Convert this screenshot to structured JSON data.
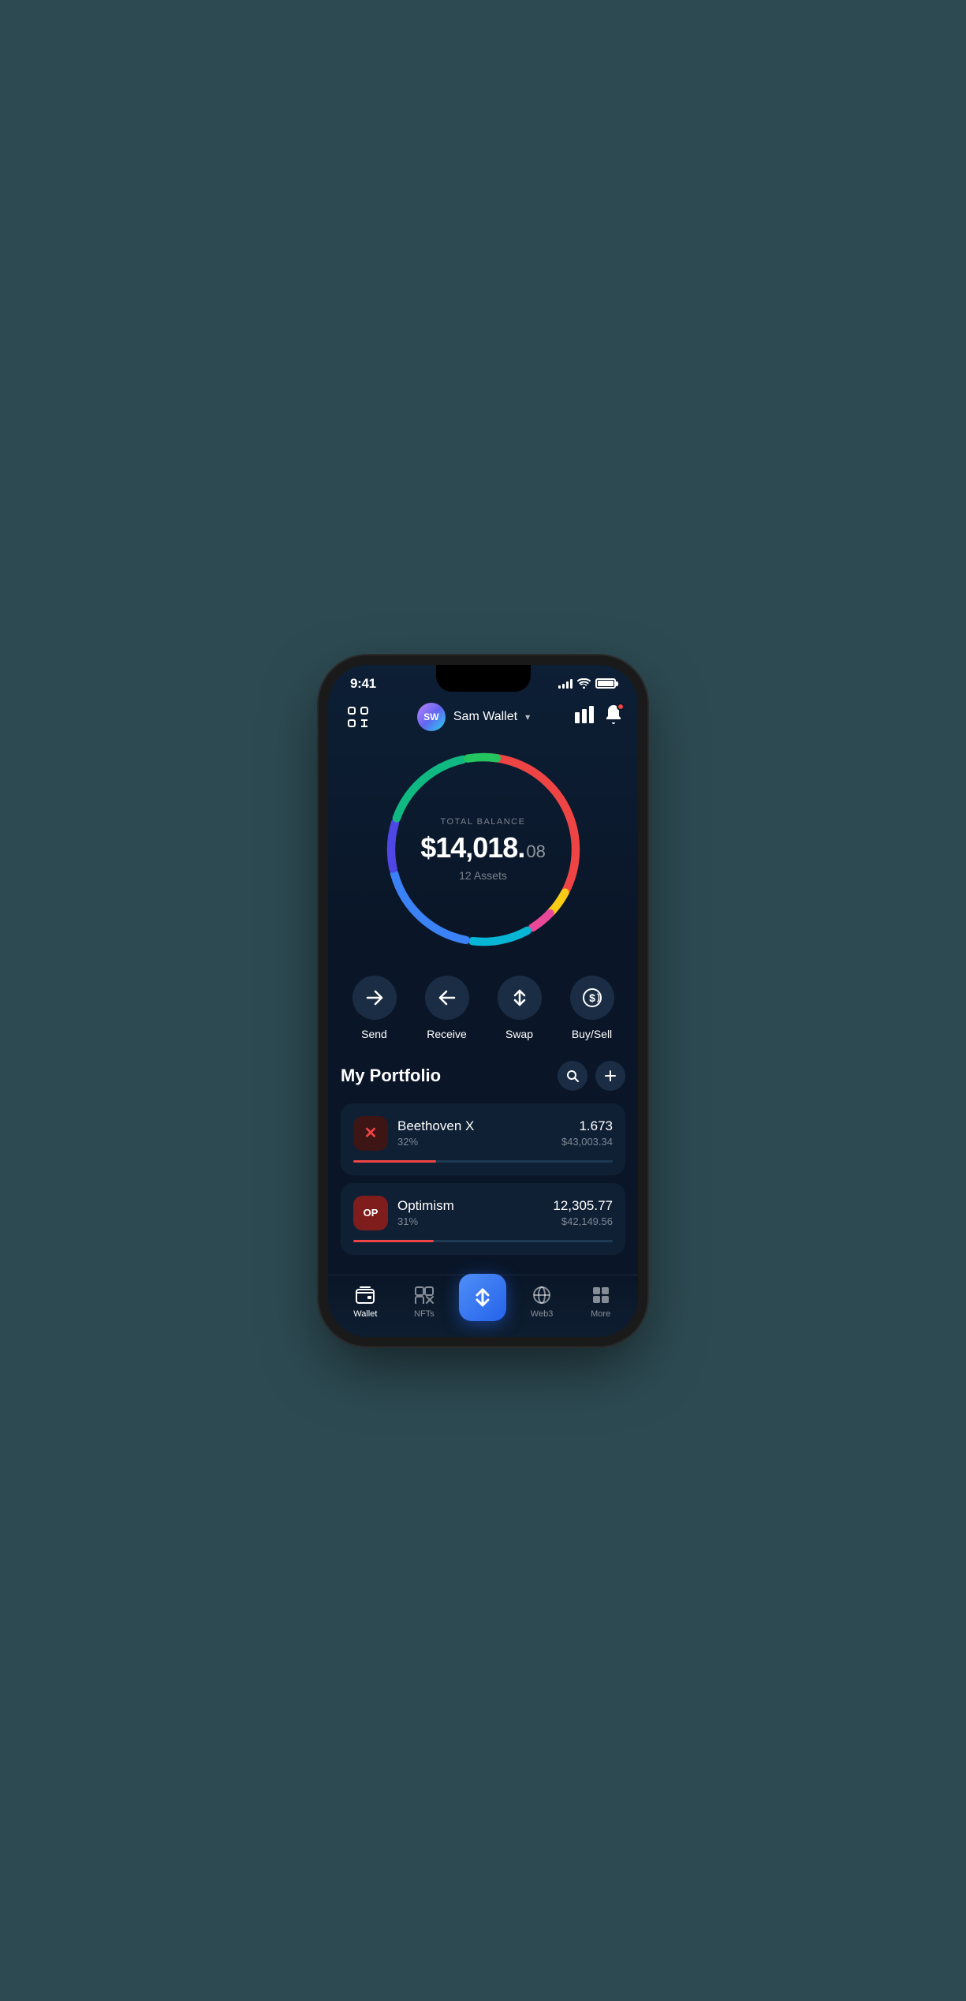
{
  "status": {
    "time": "9:41",
    "signal_bars": [
      3,
      5,
      7,
      9,
      11
    ],
    "battery_full": true
  },
  "header": {
    "avatar_initials": "SW",
    "wallet_name": "Sam Wallet",
    "dropdown_char": "▾"
  },
  "balance": {
    "label": "TOTAL BALANCE",
    "main": "$14,018.",
    "cents": "08",
    "assets_label": "12 Assets"
  },
  "actions": [
    {
      "id": "send",
      "label": "Send",
      "icon": "→"
    },
    {
      "id": "receive",
      "label": "Receive",
      "icon": "←"
    },
    {
      "id": "swap",
      "label": "Swap",
      "icon": "⇅"
    },
    {
      "id": "buysell",
      "label": "Buy/Sell",
      "icon": "ⓢ"
    }
  ],
  "portfolio": {
    "title": "My Portfolio",
    "assets": [
      {
        "id": "beethoven",
        "name": "Beethoven X",
        "pct": "32%",
        "amount": "1.673",
        "usd": "$43,003.34",
        "progress": 32,
        "progress_color": "#ef4444",
        "logo_text": "✕"
      },
      {
        "id": "optimism",
        "name": "Optimism",
        "pct": "31%",
        "amount": "12,305.77",
        "usd": "$42,149.56",
        "progress": 31,
        "progress_color": "#ef4444",
        "logo_text": "OP"
      }
    ]
  },
  "nav": {
    "items": [
      {
        "id": "wallet",
        "label": "Wallet",
        "active": true
      },
      {
        "id": "nfts",
        "label": "NFTs",
        "active": false
      },
      {
        "id": "center",
        "label": "",
        "active": false
      },
      {
        "id": "web3",
        "label": "Web3",
        "active": false
      },
      {
        "id": "more",
        "label": "More",
        "active": false
      }
    ]
  },
  "ring": {
    "segments": [
      {
        "color": "#ef4444",
        "dash": 185,
        "offset": 0
      },
      {
        "color": "#facc15",
        "dash": 30,
        "offset": 185
      },
      {
        "color": "#ec4899",
        "dash": 25,
        "offset": 215
      },
      {
        "color": "#06b6d4",
        "dash": 60,
        "offset": 245
      },
      {
        "color": "#3b82f6",
        "dash": 100,
        "offset": 310
      },
      {
        "color": "#6366f1",
        "dash": 50,
        "offset": 415
      },
      {
        "color": "#10b981",
        "dash": 95,
        "offset": 470
      },
      {
        "color": "#22c55e",
        "dash": 30,
        "offset": 565
      }
    ],
    "circumference": 628
  }
}
